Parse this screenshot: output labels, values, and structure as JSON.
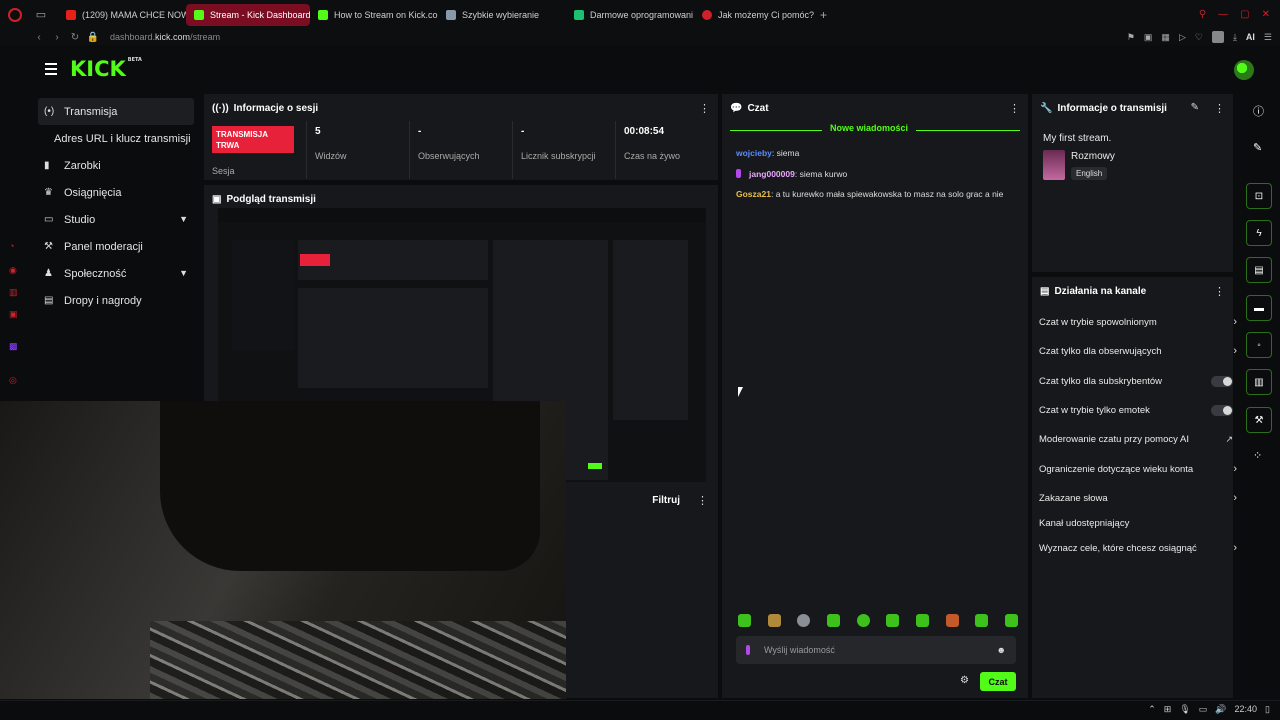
{
  "browser": {
    "tabs": [
      {
        "label": "(1209) MAMA CHCE NOW",
        "color": "#e62117"
      },
      {
        "label": "Stream - Kick Dashboard",
        "color": "#53fc18",
        "active": true
      },
      {
        "label": "How to Stream on Kick.co",
        "color": "#53fc18"
      },
      {
        "label": "Szybkie wybieranie",
        "color": "#8899aa"
      },
      {
        "label": "Darmowe oprogramowani",
        "color": "#1dbf73"
      },
      {
        "label": "Jak możemy Ci pomóc? -",
        "color": "#d0202a"
      }
    ],
    "new_tab": "+",
    "url_host": "dashboard.",
    "url_domain": "kick.com",
    "url_path": "/stream",
    "ai_label": "AI"
  },
  "header": {
    "logo": "KICK",
    "logo_badge": "BETA"
  },
  "nav": {
    "items": [
      {
        "label": "Transmisja",
        "icon": "(•)"
      },
      {
        "label": "Adres URL i klucz transmisji",
        "icon": ""
      },
      {
        "label": "Zarobki",
        "icon": "▮"
      },
      {
        "label": "Osiągnięcia",
        "icon": "🏆"
      },
      {
        "label": "Studio",
        "icon": "▭"
      },
      {
        "label": "Panel moderacji",
        "icon": "⚒"
      },
      {
        "label": "Społeczność",
        "icon": "👥"
      },
      {
        "label": "Dropy i nagrody",
        "icon": "▤"
      }
    ]
  },
  "session": {
    "title": "Informacje o sesji",
    "live_badge": "TRANSMISJA TRWA",
    "stats": [
      {
        "value": "",
        "label": "Sesja"
      },
      {
        "value": "5",
        "label": "Widzów"
      },
      {
        "value": "-",
        "label": "Obserwujących"
      },
      {
        "value": "-",
        "label": "Licznik subskrypcji"
      },
      {
        "value": "00:08:54",
        "label": "Czas na żywo"
      }
    ]
  },
  "preview": {
    "title": "Podgląd transmisji",
    "filter_label": "Filtruj"
  },
  "chat": {
    "title": "Czat",
    "new_messages": "Nowe wiadomości",
    "messages": [
      {
        "user": "wojcieby",
        "color": "#5b8cff",
        "text": ": siema"
      },
      {
        "user": "jang000009",
        "color": "#e8a6ff",
        "text": ": siema kurwo"
      },
      {
        "user": "Gosza21",
        "color": "#e8c04a",
        "text": ": a tu kurewko mała spiewakowska to masz na solo grac a nie"
      }
    ],
    "input_placeholder": "Wyślij wiadomość",
    "send_label": "Czat"
  },
  "stream_info": {
    "title": "Informacje o transmisji",
    "stream_title": "My first stream.",
    "category": "Rozmowy",
    "language": "English"
  },
  "channel_actions": {
    "title": "Działania na kanale",
    "items": [
      {
        "label": "Czat w trybie spowolnionym",
        "control": "arrow"
      },
      {
        "label": "Czat tylko dla obserwujących",
        "control": "arrow"
      },
      {
        "label": "Czat tylko dla subskrybentów",
        "control": "toggle"
      },
      {
        "label": "Czat w trybie tylko emotek",
        "control": "toggle"
      },
      {
        "label": "Moderowanie czatu przy pomocy AI",
        "control": "external"
      },
      {
        "label": "Ograniczenie dotyczące wieku konta",
        "control": "arrow"
      },
      {
        "label": "Zakazane słowa",
        "control": "arrow"
      },
      {
        "label": "Kanał udostępniający",
        "control": "none"
      },
      {
        "label": "Wyznacz cele, które chcesz osiągnąć",
        "control": "arrow"
      }
    ]
  },
  "taskbar": {
    "time": "22:40"
  },
  "colors": {
    "brand": "#53fc18",
    "live": "#e8213a",
    "panel": "#17181b",
    "background": "#0b0c0e"
  }
}
